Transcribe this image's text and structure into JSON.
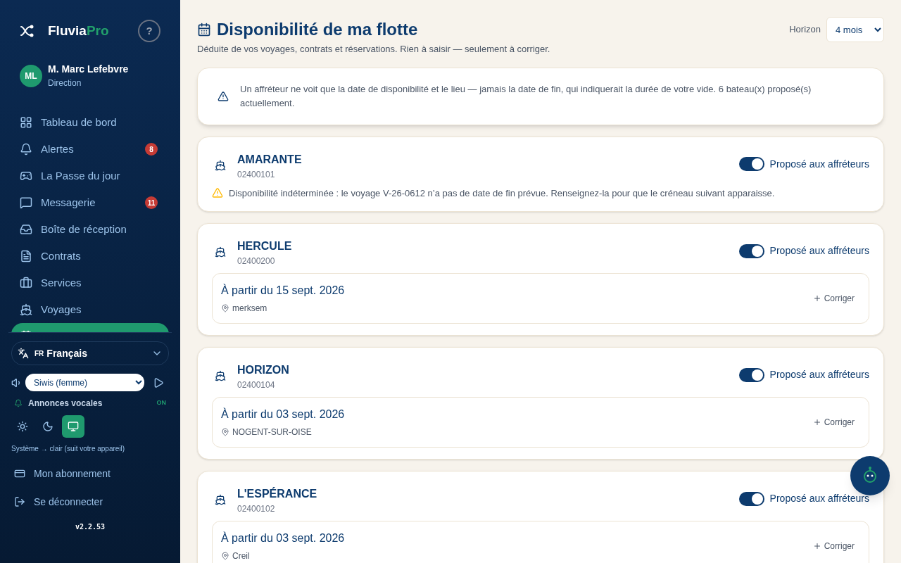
{
  "brand": {
    "name": "Fluvia",
    "suffix": "Pro",
    "help": "?"
  },
  "user": {
    "initials": "ML",
    "name": "M. Marc Lefebvre",
    "role": "Direction"
  },
  "nav": [
    {
      "label": "Tableau de bord",
      "selected": false
    },
    {
      "label": "Alertes",
      "badge": "8",
      "selected": false
    },
    {
      "label": "La Passe du jour",
      "selected": false
    },
    {
      "label": "Messagerie",
      "badge": "11",
      "selected": false
    },
    {
      "label": "Boîte de réception",
      "selected": false
    },
    {
      "label": "Contrats",
      "selected": false
    },
    {
      "label": "Services",
      "selected": false
    },
    {
      "label": "Voyages",
      "selected": false
    },
    {
      "selected": true
    }
  ],
  "language": {
    "code": "FR",
    "label": "Français"
  },
  "voice": {
    "value": "Siwis (femme)"
  },
  "announcements": {
    "label": "Annonces vocales",
    "state": "ON",
    "on": true
  },
  "themes": [
    {
      "kind": "light",
      "selected": false
    },
    {
      "kind": "dark",
      "selected": false
    },
    {
      "kind": "system",
      "selected": true
    }
  ],
  "theme_note": "Système → clair (suit votre appareil)",
  "footer_links": [
    {
      "kind": "subscription",
      "label": "Mon abonnement"
    },
    {
      "kind": "logout",
      "label": "Se déconnecter"
    }
  ],
  "version": "v2.2.53",
  "page": {
    "title": "Disponibilité de ma flotte",
    "subtitle": "Déduite de vos voyages, contrats et réservations. Rien à saisir — seulement à corriger.",
    "horizon_label": "Horizon",
    "horizon_value": "4 mois"
  },
  "notice": "Un affréteur ne voit que la date de disponibilité et le lieu — jamais la date de fin, qui indiquerait la durée de votre vide. 6 bateau(x) proposé(s) actuellement.",
  "boats": [
    {
      "name": "AMARANTE",
      "code": "02400101",
      "offer_label": "Proposé aux affréteurs",
      "offered": true,
      "kind": "warning",
      "warning": "Disponibilité indéterminée : le voyage V-26-0612 n’a pas de date de fin prévue. Renseignez-la pour que le créneau suivant apparaisse."
    },
    {
      "name": "HERCULE",
      "code": "02400200",
      "offer_label": "Proposé aux affréteurs",
      "offered": true,
      "kind": "slot",
      "date": "À partir du 15 sept. 2026",
      "place": "merksem",
      "action": "Corriger"
    },
    {
      "name": "HORIZON",
      "code": "02400104",
      "offer_label": "Proposé aux affréteurs",
      "offered": true,
      "kind": "slot",
      "date": "À partir du 03 sept. 2026",
      "place": "NOGENT-SUR-OISE",
      "action": "Corriger"
    },
    {
      "name": "L'ESPÉRANCE",
      "code": "02400102",
      "offer_label": "Proposé aux affréteurs",
      "offered": true,
      "kind": "slot",
      "date": "À partir du 03 sept. 2026",
      "place": "Creil",
      "action": "Corriger"
    }
  ]
}
